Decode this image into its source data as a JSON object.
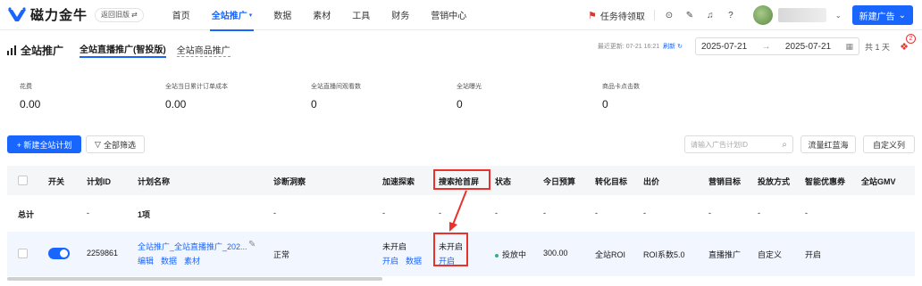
{
  "app": {
    "brand": "磁力金牛",
    "old_version": "返回旧版",
    "nav": [
      "首页",
      "全站推广",
      "数据",
      "素材",
      "工具",
      "财务",
      "营销中心"
    ],
    "task": "任务待领取",
    "new_ad": "新建广告"
  },
  "page": {
    "title": "全站推广",
    "tab_active": "全站直播推广(智投版)",
    "tab_other": "全站商品推广",
    "last_update": "最近更新: 07-21 16:21",
    "refresh": "刷新",
    "date_start": "2025-07-21",
    "date_end": "2025-07-21",
    "date_sep": "→",
    "days": "共 1 天",
    "gift_badge": "2"
  },
  "metrics": [
    {
      "label": "花费",
      "value": "0.00"
    },
    {
      "label": "全站当日累计订单成本",
      "value": "0.00"
    },
    {
      "label": "全站直播间观看数",
      "value": "0"
    },
    {
      "label": "全站曝光",
      "value": "0"
    },
    {
      "label": "商品卡点击数",
      "value": "0"
    }
  ],
  "toolbar": {
    "new_plan": "+ 新建全站计划",
    "filter": "全部筛选",
    "search_placeholder": "请输入广告计划ID",
    "traffic": "流量红蓝海",
    "custom_cols": "自定义列"
  },
  "table": {
    "headers": {
      "switch": "开关",
      "plan_id": "计划ID",
      "plan_name": "计划名称",
      "diagnosis": "诊断洞察",
      "boost": "加速探索",
      "search_top": "搜索抢首屏",
      "status": "状态",
      "budget": "今日预算",
      "goal": "转化目标",
      "bid": "出价",
      "marketing": "营销目标",
      "delivery": "投放方式",
      "coupon": "智能优惠券",
      "gmv": "全站GMV"
    },
    "total": {
      "label": "总计",
      "plan_id": "-",
      "plan_name": "1项",
      "diagnosis": "-",
      "boost": "-",
      "search_top": "-",
      "status": "-",
      "budget": "-",
      "goal": "-",
      "bid": "-",
      "marketing": "-",
      "delivery": "-",
      "coupon": "-"
    },
    "row": {
      "plan_id": "2259861",
      "plan_name": "全站推广_全站直播推广_202...",
      "actions": [
        "编辑",
        "数据",
        "素材"
      ],
      "diagnosis": "正常",
      "boost_status": "未开启",
      "boost_actions": [
        "开启",
        "数据"
      ],
      "search_status": "未开启",
      "search_action": "开启",
      "status": "投放中",
      "budget": "300.00",
      "goal": "全站ROI",
      "bid": "ROI系数5.0",
      "marketing": "直播推广",
      "delivery": "自定义",
      "coupon": "开启"
    }
  },
  "colors": {
    "accent": "#1966ff",
    "annotation": "#e8322b",
    "status_green": "#2db47d"
  }
}
